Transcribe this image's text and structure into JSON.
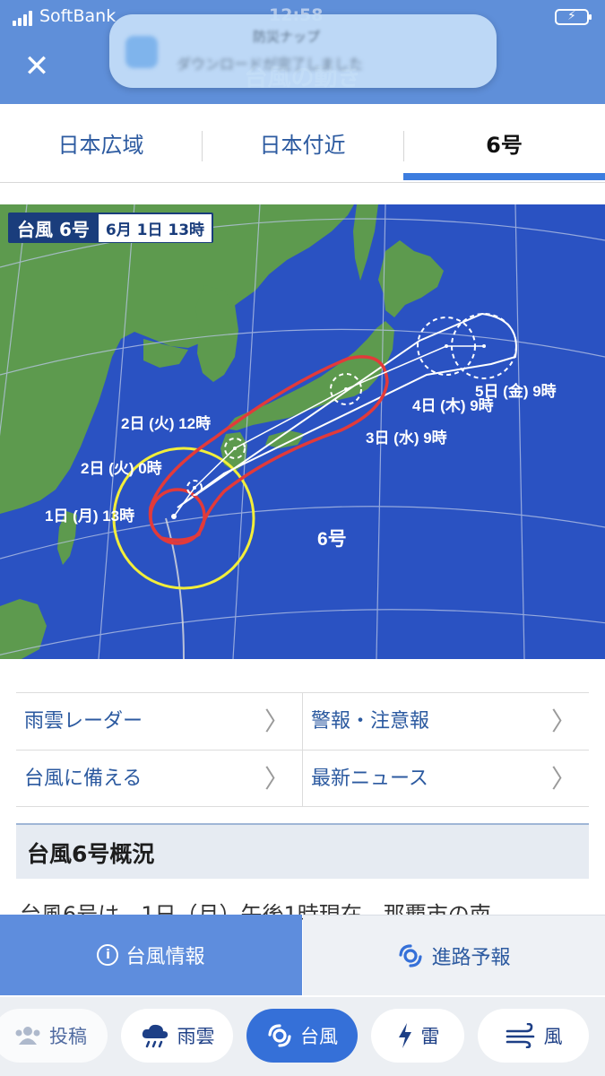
{
  "status_bar": {
    "carrier": "SoftBank",
    "time": "12:58"
  },
  "header": {
    "title": "台風の動き",
    "close_icon": "close-icon"
  },
  "notification": {
    "app_title": "防災ナップ",
    "message": "ダウンロードが完了しました"
  },
  "tabs": [
    {
      "label": "日本広域",
      "selected": false
    },
    {
      "label": "日本付近",
      "selected": false
    },
    {
      "label": "6号",
      "selected": true
    }
  ],
  "map": {
    "badge_name": "台風 6号",
    "badge_time": "6月 1日 13時",
    "typhoon_label": "6号",
    "track_points": [
      {
        "label": "1日 (月) 13時"
      },
      {
        "label": "2日 (火) 0時"
      },
      {
        "label": "2日 (火) 12時"
      },
      {
        "label": "3日 (水) 9時"
      },
      {
        "label": "4日 (木) 9時"
      },
      {
        "label": "5日 (金) 9時"
      }
    ],
    "colors": {
      "sea": "#2a52c2",
      "land": "#5d9a4e",
      "storm_area": "#e23a3a",
      "gale_area": "#f2ee3a",
      "forecast_circle": "#ffffff"
    }
  },
  "links": [
    {
      "label": "雨雲レーダー"
    },
    {
      "label": "警報・注意報"
    },
    {
      "label": "台風に備える"
    },
    {
      "label": "最新ニュース"
    }
  ],
  "section": {
    "title": "台風6号概況",
    "text": "台風6号は、1日（月）午後1時現在、那覇市の南"
  },
  "segment": {
    "info_label": "台風情報",
    "forecast_label": "進路予報"
  },
  "bottom_nav": [
    {
      "label": "投稿",
      "icon": "people-icon"
    },
    {
      "label": "雨雲",
      "icon": "rain-cloud-icon"
    },
    {
      "label": "台風",
      "icon": "typhoon-icon",
      "selected": true
    },
    {
      "label": "雷",
      "icon": "lightning-icon"
    },
    {
      "label": "風",
      "icon": "wind-icon"
    }
  ]
}
